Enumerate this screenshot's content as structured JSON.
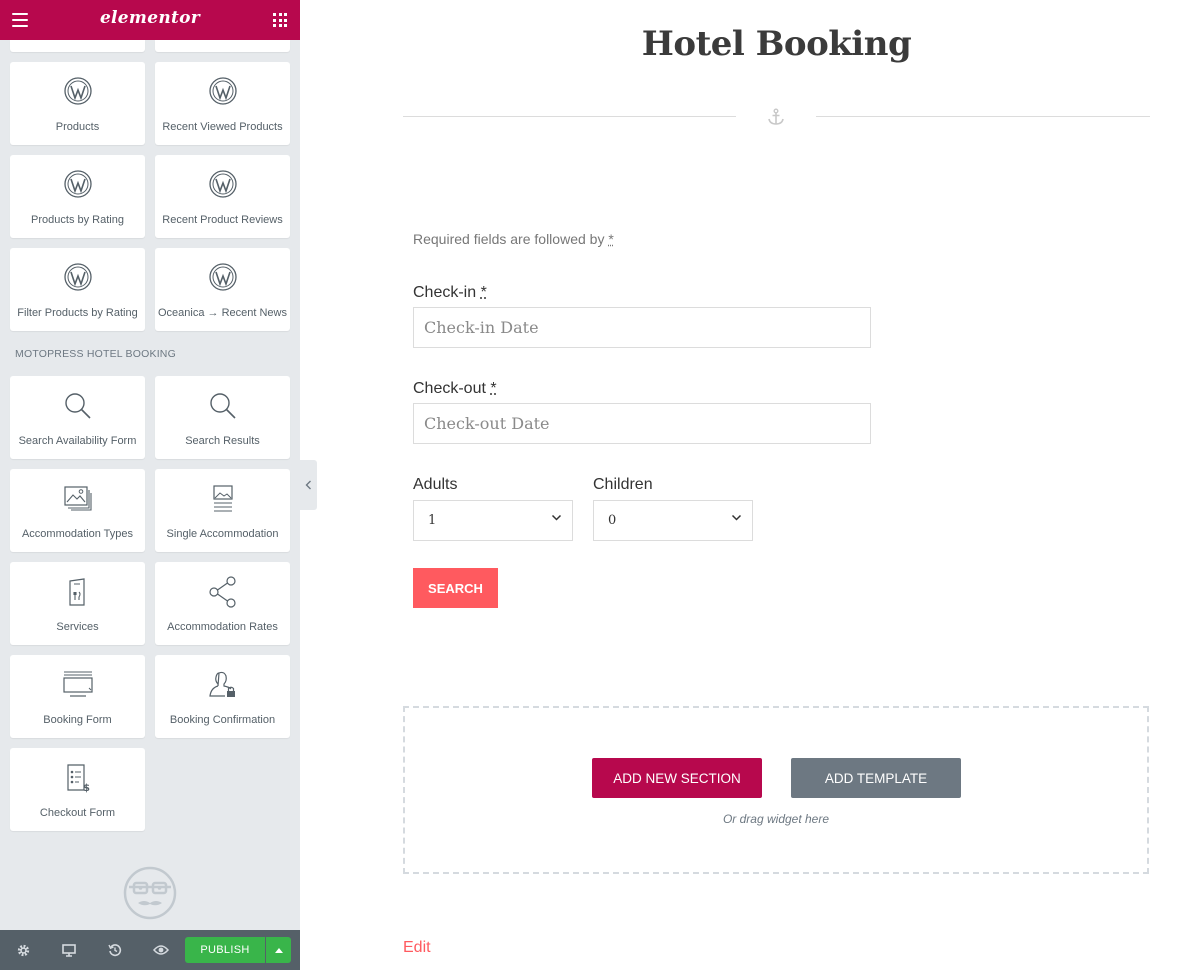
{
  "app": {
    "logo_text": "elementor",
    "brand_color": "#b7084d"
  },
  "panel": {
    "cards": [
      {
        "label": "Products",
        "icon": "wordpress-icon"
      },
      {
        "label": "Recent Viewed Products",
        "icon": "wordpress-icon"
      },
      {
        "label": "Products by Rating",
        "icon": "wordpress-icon"
      },
      {
        "label": "Recent Product Reviews",
        "icon": "wordpress-icon"
      },
      {
        "label": "Filter Products by Rating",
        "icon": "wordpress-icon"
      },
      {
        "label": "Oceanica → Recent News",
        "icon": "wordpress-icon"
      }
    ],
    "category_title": "MOTOPRESS HOTEL BOOKING",
    "hotel_cards": [
      {
        "label": "Search Availability Form",
        "icon": "search-icon"
      },
      {
        "label": "Search Results",
        "icon": "search-icon"
      },
      {
        "label": "Accommodation Types",
        "icon": "gallery-icon"
      },
      {
        "label": "Single Accommodation",
        "icon": "image-text-icon"
      },
      {
        "label": "Services",
        "icon": "menu-card-icon"
      },
      {
        "label": "Accommodation Rates",
        "icon": "share-icon"
      },
      {
        "label": "Booking Form",
        "icon": "form-screen-icon"
      },
      {
        "label": "Booking Confirmation",
        "icon": "user-lock-icon"
      },
      {
        "label": "Checkout Form",
        "icon": "invoice-icon"
      }
    ],
    "footer": {
      "publish_label": "PUBLISH",
      "publish_color": "#39b54a"
    }
  },
  "page": {
    "title": "Hotel Booking",
    "required_note": "Required fields are followed by",
    "required_marker": "*",
    "checkin": {
      "label": "Check-in",
      "placeholder": "Check-in Date"
    },
    "checkout": {
      "label": "Check-out",
      "placeholder": "Check-out Date"
    },
    "adults": {
      "label": "Adults",
      "value": "1"
    },
    "children": {
      "label": "Children",
      "value": "0"
    },
    "search_label": "SEARCH",
    "accent_color": "#ff5a5f",
    "add_section_label": "ADD NEW SECTION",
    "add_template_label": "ADD TEMPLATE",
    "drag_hint": "Or drag widget here",
    "edit_link": "Edit"
  }
}
